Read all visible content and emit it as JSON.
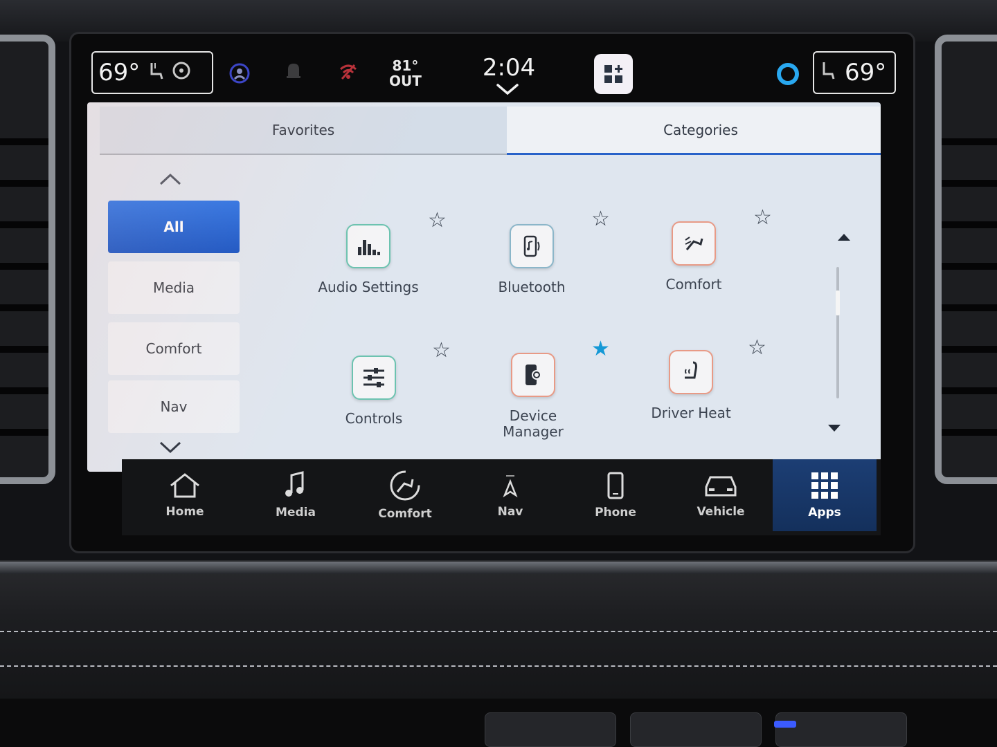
{
  "status_bar": {
    "driver_temp": "69°",
    "passenger_temp": "69°",
    "outside_temp": "81°",
    "outside_label": "OUT",
    "clock": "2:04"
  },
  "tabs": [
    {
      "label": "Favorites",
      "selected": false
    },
    {
      "label": "Categories",
      "selected": true
    }
  ],
  "categories": [
    {
      "label": "All",
      "selected": true
    },
    {
      "label": "Media",
      "selected": false
    },
    {
      "label": "Comfort",
      "selected": false
    },
    {
      "label": "Nav",
      "selected": false
    }
  ],
  "apps": [
    {
      "label": "Audio Settings",
      "icon": "equalizer-icon",
      "favorite": false
    },
    {
      "label": "Bluetooth",
      "icon": "bluetooth-phone-icon",
      "favorite": false
    },
    {
      "label": "Comfort",
      "icon": "seat-airflow-icon",
      "favorite": false
    },
    {
      "label": "Controls",
      "icon": "sliders-icon",
      "favorite": false
    },
    {
      "label": "Device Manager",
      "label_line1": "Device",
      "label_line2": "Manager",
      "icon": "device-gear-icon",
      "favorite": true
    },
    {
      "label": "Driver Heat",
      "icon": "heated-seat-icon",
      "favorite": false
    }
  ],
  "bottom_nav": [
    {
      "label": "Home",
      "icon": "home-icon",
      "active": false
    },
    {
      "label": "Media",
      "icon": "music-note-icon",
      "active": false
    },
    {
      "label": "Comfort",
      "icon": "comfort-seat-icon",
      "active": false
    },
    {
      "label": "Nav",
      "icon": "compass-icon",
      "active": false
    },
    {
      "label": "Phone",
      "icon": "phone-icon",
      "active": false
    },
    {
      "label": "Vehicle",
      "icon": "car-icon",
      "active": false
    },
    {
      "label": "Apps",
      "icon": "apps-grid-icon",
      "active": true
    }
  ],
  "colors": {
    "accent_blue": "#1553c4",
    "favorite_star": "#1599d6",
    "active_nav": "#1c3e74"
  }
}
